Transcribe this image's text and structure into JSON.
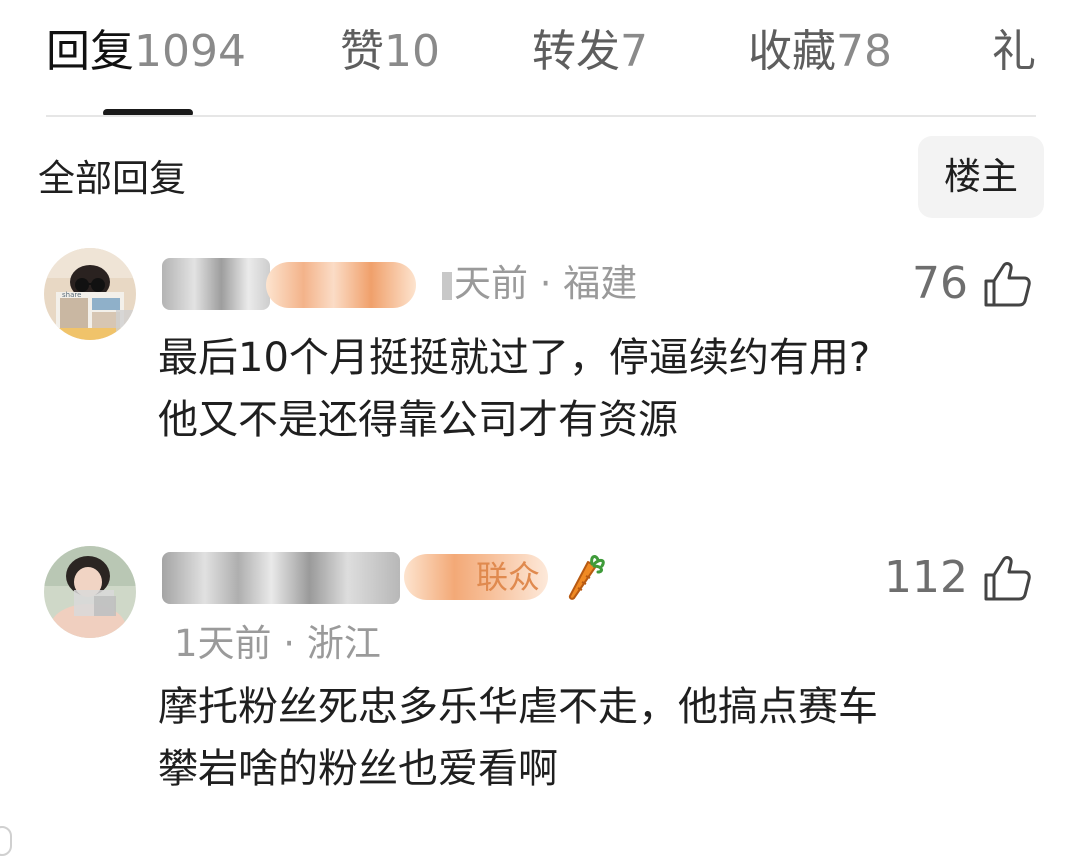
{
  "tabs": [
    {
      "label": "回复",
      "count": "1094",
      "active": true
    },
    {
      "label": "赞",
      "count": "10",
      "active": false
    },
    {
      "label": "转发",
      "count": "7",
      "active": false
    },
    {
      "label": "收藏",
      "count": "78",
      "active": false
    },
    {
      "label": "礼",
      "count": "",
      "active": false
    }
  ],
  "filter": {
    "title": "全部回复",
    "op_button": "楼主"
  },
  "comments": [
    {
      "meta": "天前 · 福建",
      "likes": "76",
      "text_line1": "最后10个月挺挺就过了，停逼续约有用?",
      "text_line2": "他又不是还得靠公司才有资源"
    },
    {
      "badge_text": "联众",
      "meta": "1天前 · 浙江",
      "likes": "112",
      "text_line1": "摩托粉丝死忠多乐华虐不走，他搞点赛车",
      "text_line2": "攀岩啥的粉丝也爱看啊"
    }
  ],
  "colors": {
    "active_text": "#111111",
    "muted_text": "#9a9a9a",
    "accent_badge": "#f2a66a"
  },
  "icons": {
    "like": "thumbs-up-icon",
    "badge": "carrot-icon"
  }
}
